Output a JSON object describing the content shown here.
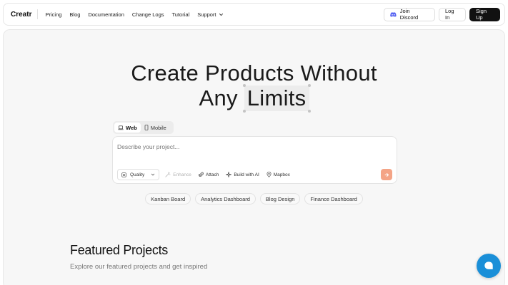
{
  "nav": {
    "brand": "Creatr",
    "links": [
      "Pricing",
      "Blog",
      "Documentation",
      "Change Logs",
      "Tutorial",
      "Support"
    ],
    "discord_label": "Join Discord",
    "login_label": "Log In",
    "signup_label": "Sign Up",
    "discord_icon": "discord-icon",
    "support_icon": "chevron-down-icon"
  },
  "hero": {
    "line1": "Create Products Without",
    "line2_prefix": "Any",
    "line2_highlight": "Limits"
  },
  "tabs": [
    {
      "label": "Web",
      "icon": "laptop-icon",
      "active": true
    },
    {
      "label": "Mobile",
      "icon": "phone-icon",
      "active": false
    }
  ],
  "prompt": {
    "placeholder": "Describe your project...",
    "quality_label": "Quality",
    "tools": [
      {
        "label": "Enhance",
        "icon": "sparkle-icon",
        "disabled": true
      },
      {
        "label": "Attach",
        "icon": "paperclip-icon",
        "disabled": false
      },
      {
        "label": "Build with AI",
        "icon": "magic-icon",
        "disabled": false
      },
      {
        "label": "Mapbox",
        "icon": "map-pin-icon",
        "disabled": false
      }
    ],
    "send_color": "#f4a486"
  },
  "chips": [
    "Kanban Board",
    "Analytics Dashboard",
    "Blog Design",
    "Finance Dashboard"
  ],
  "featured": {
    "title": "Featured Projects",
    "subtitle": "Explore our featured projects and get inspired"
  },
  "colors": {
    "accent_dark": "#111111",
    "chat_blue": "#1a8fd8"
  }
}
